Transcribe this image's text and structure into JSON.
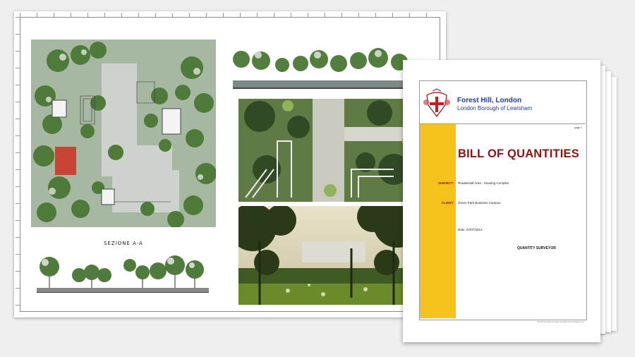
{
  "drawing_sheet": {
    "section_title": "SEZIONE A-A"
  },
  "document": {
    "organization": "Forest Hill, London",
    "borough": "London Borough of Lewisham",
    "page_label": "page 1",
    "title": "BILL OF QUANTITIES",
    "subject_label": "SUBJECT:",
    "subject_value": "Residential Area - Housing Complex",
    "client_label": "CLIENT:",
    "client_value": "Green Park Business Campus",
    "date_text": "Date, 07/07/2013",
    "role": "QUANTITY SURVEYOR",
    "footer": "Printed by Studio Users@ copyright ACCA software S.p.A."
  },
  "colors": {
    "boq_red": "#8c1313",
    "org_blue": "#1f37b5",
    "band_yellow": "#f5c21b",
    "plan_green": "#9fb29b"
  }
}
